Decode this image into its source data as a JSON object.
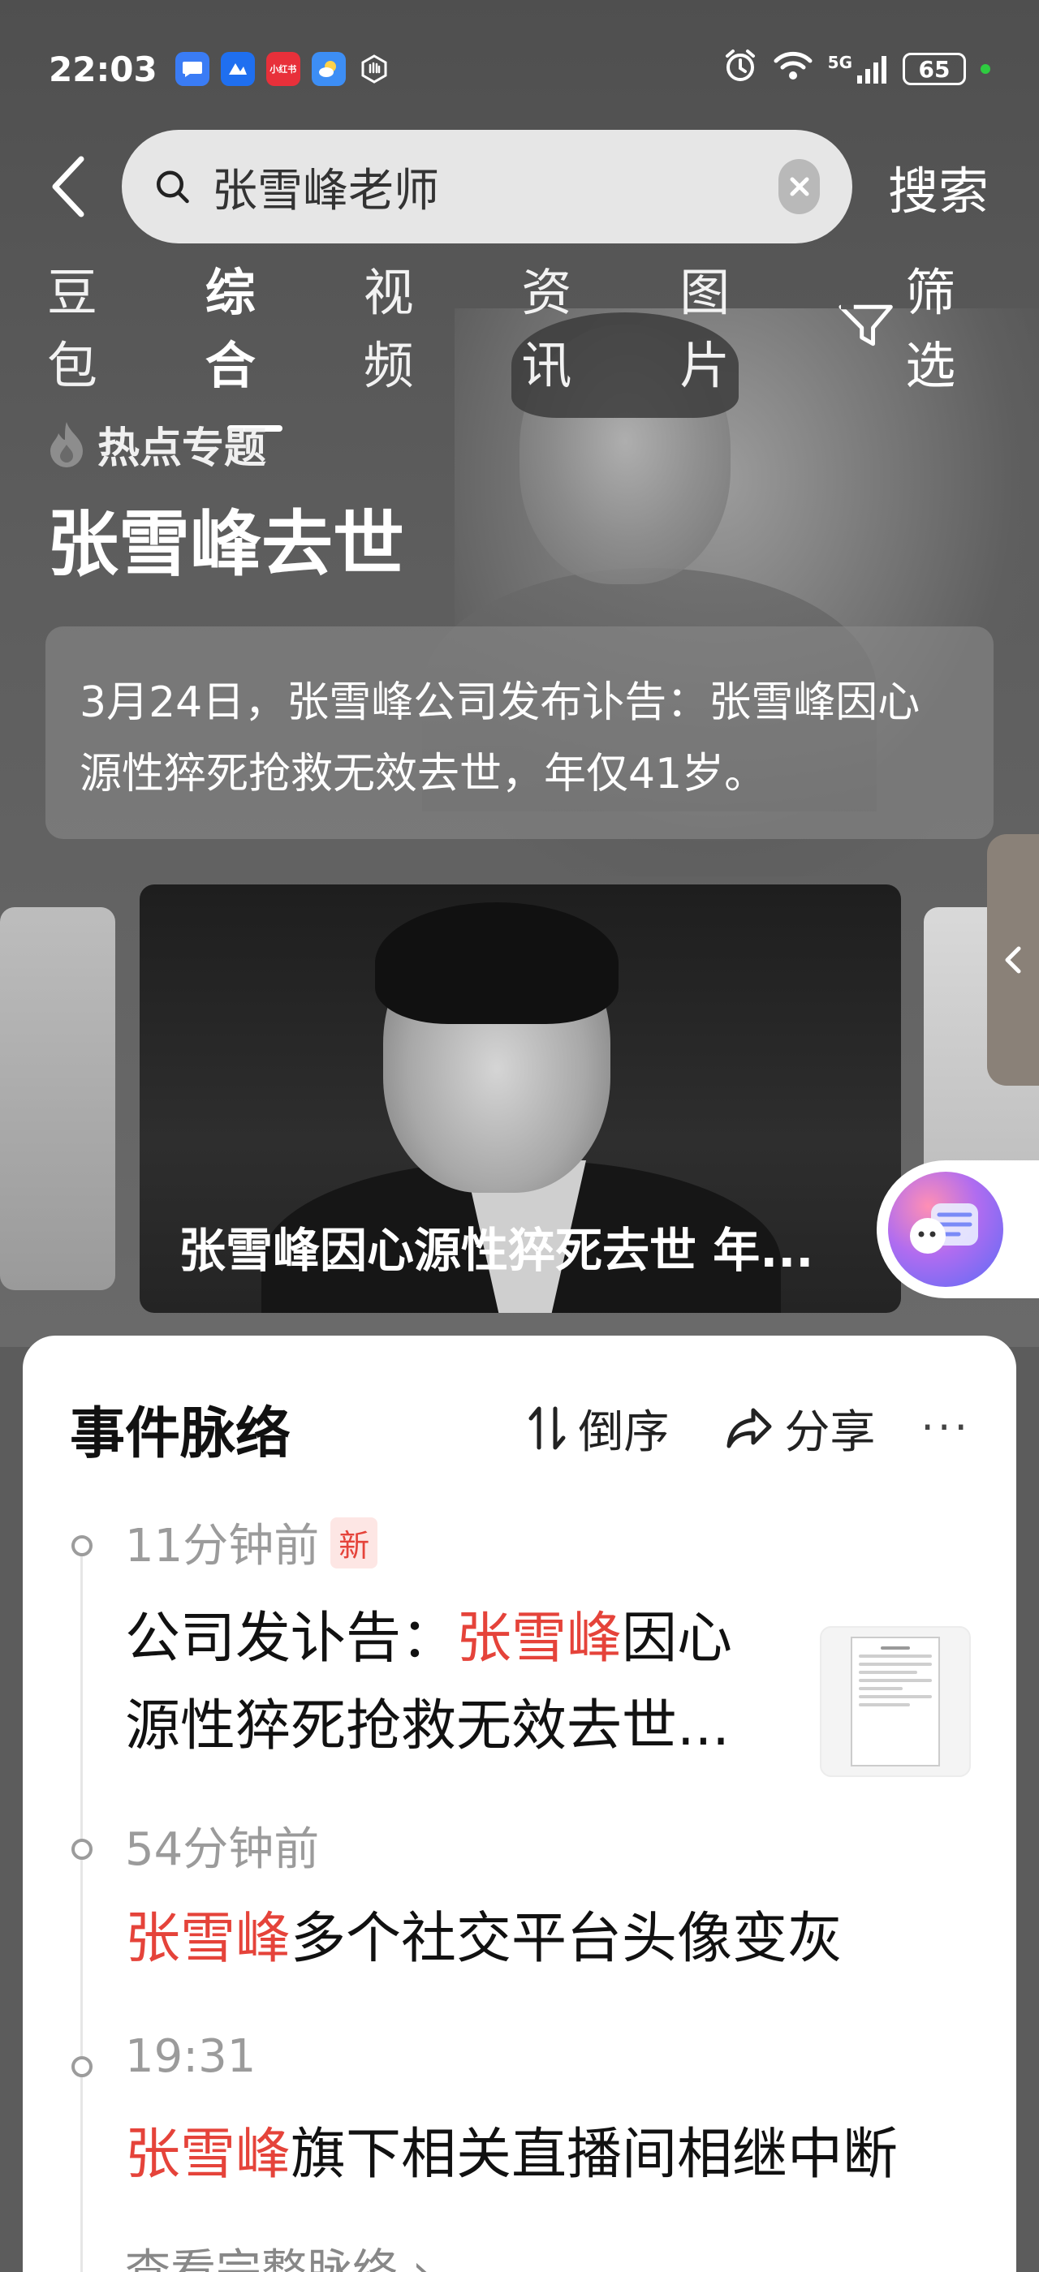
{
  "status_bar": {
    "time": "22:03",
    "apps": [
      {
        "icon": "chat-bubble-icon",
        "color": "#3a7cf5"
      },
      {
        "icon": "ding-icon",
        "color": "#1f6ff0"
      },
      {
        "icon": "xiaohongshu-icon",
        "color": "#e8303a",
        "label": "小红书"
      },
      {
        "icon": "weather-icon",
        "color": "#3d8ef5"
      },
      {
        "icon": "hand-icon",
        "color": "#5a5a5a"
      }
    ],
    "network": "5G",
    "battery": "65"
  },
  "search": {
    "query": "张雪峰老师",
    "submit_label": "搜索"
  },
  "tabs": [
    {
      "label": "豆包"
    },
    {
      "label": "综合",
      "active": true
    },
    {
      "label": "视频"
    },
    {
      "label": "资讯"
    },
    {
      "label": "图片"
    }
  ],
  "filter_label": "筛选",
  "hot_topic": {
    "label": "热点专题",
    "title": "张雪峰去世",
    "summary": "3月24日，张雪峰公司发布讣告：张雪峰因心源性猝死抢救无效去世，年仅41岁。"
  },
  "carousel": {
    "caption": "张雪峰因心源性猝死去世 年..."
  },
  "timeline": {
    "title": "事件脉络",
    "sort_label": "倒序",
    "share_label": "分享",
    "items": [
      {
        "time": "11分钟前",
        "badge": "新",
        "highlight": "张雪峰",
        "prefix": "公司发讣告：",
        "line1_rest": "因心",
        "line2": "源性猝死抢救无效去世..."
      },
      {
        "time": "54分钟前",
        "highlight": "张雪峰",
        "rest": "多个社交平台头像变灰"
      },
      {
        "time": "19:31",
        "highlight": "张雪峰",
        "rest": "旗下相关直播间相继中断"
      }
    ],
    "view_more": "查看完整脉络 ›"
  }
}
